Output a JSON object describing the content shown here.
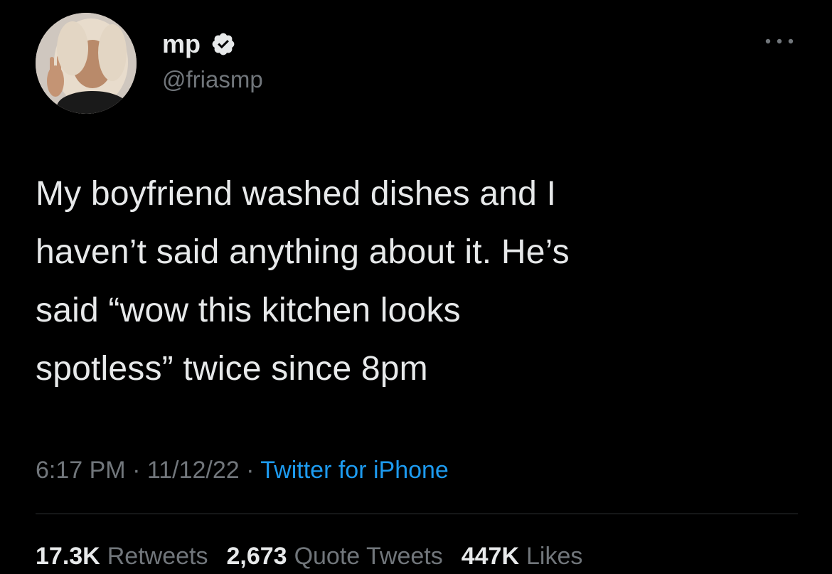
{
  "author": {
    "display_name": "mp",
    "handle": "@friasmp",
    "verified": true,
    "avatar_icon": "profile-photo"
  },
  "menu": {
    "more_icon": "ellipsis-icon"
  },
  "tweet": {
    "text_lines": [
      "My boyfriend washed dishes and I",
      "haven’t said anything about it. He’s",
      "said “wow this kitchen looks",
      "spotless” twice since 8pm"
    ]
  },
  "meta": {
    "time": "6:17 PM",
    "separator": " · ",
    "date": "11/12/22",
    "source": "Twitter for iPhone"
  },
  "stats": {
    "retweets_count": "17.3K",
    "retweets_label": "Retweets",
    "quotes_count": "2,673",
    "quotes_label": "Quote Tweets",
    "likes_count": "447K",
    "likes_label": "Likes"
  },
  "colors": {
    "background": "#000000",
    "primary_text": "#e7e9ea",
    "secondary_text": "#71767b",
    "link": "#1d9bf0",
    "divider": "#2f3336"
  }
}
